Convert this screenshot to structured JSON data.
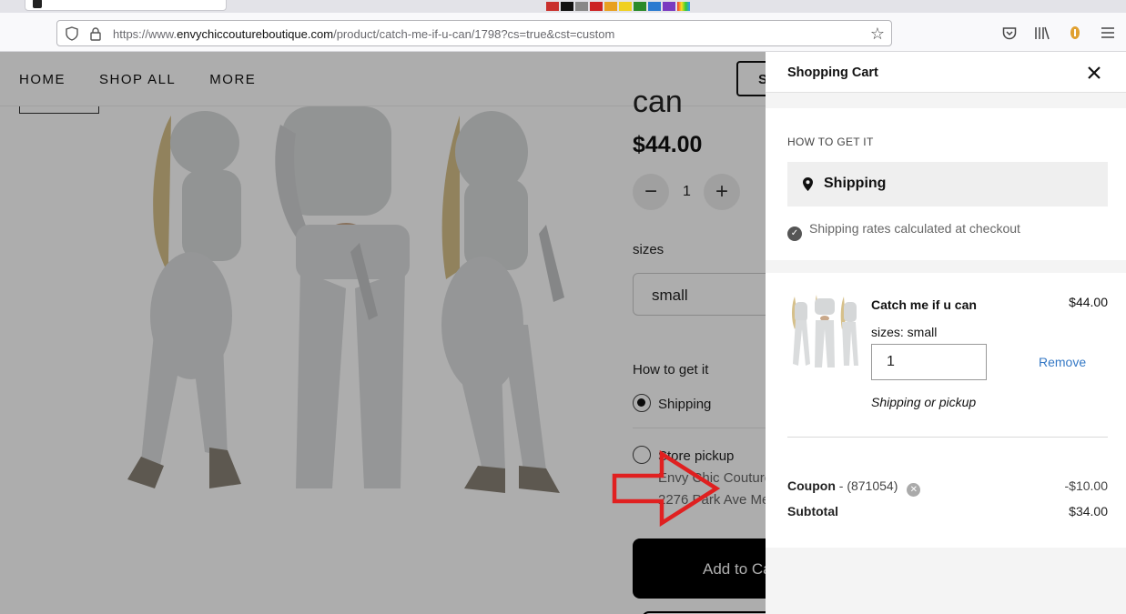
{
  "browser": {
    "url_prefix": "https://www.",
    "url_domain": "envychiccoutureboutique.com",
    "url_path": "/product/catch-me-if-u-can/1798?cs=true&cst=custom"
  },
  "site": {
    "nav": [
      "HOME",
      "SHOP ALL",
      "MORE"
    ],
    "search_fragment": "S"
  },
  "product": {
    "title_fragment": "can",
    "price": "$44.00",
    "quantity": "1",
    "sizes_label": "sizes",
    "size_selected": "small",
    "how_to_label": "How to get it",
    "option_shipping": "Shipping",
    "option_pickup": "Store pickup",
    "pickup_line1": "Envy Chic Couture",
    "pickup_line2": "2276 Park Ave Me",
    "add_to_cart": "Add to Ca"
  },
  "cart": {
    "title": "Shopping Cart",
    "how_to_caption": "HOW TO GET IT",
    "shipping_option": "Shipping",
    "rates_note": "Shipping rates calculated at checkout",
    "item": {
      "name": "Catch me if u can",
      "price": "$44.00",
      "size": "sizes: small",
      "quantity": "1",
      "remove": "Remove",
      "fulfillment": "Shipping or pickup"
    },
    "coupon_label": "Coupon",
    "coupon_code": " - (871054)",
    "coupon_value": "-$10.00",
    "subtotal_label": "Subtotal",
    "subtotal_value": "$34.00"
  },
  "colors": {
    "accent_link": "#3478c5",
    "annotation_arrow": "#e02020"
  }
}
